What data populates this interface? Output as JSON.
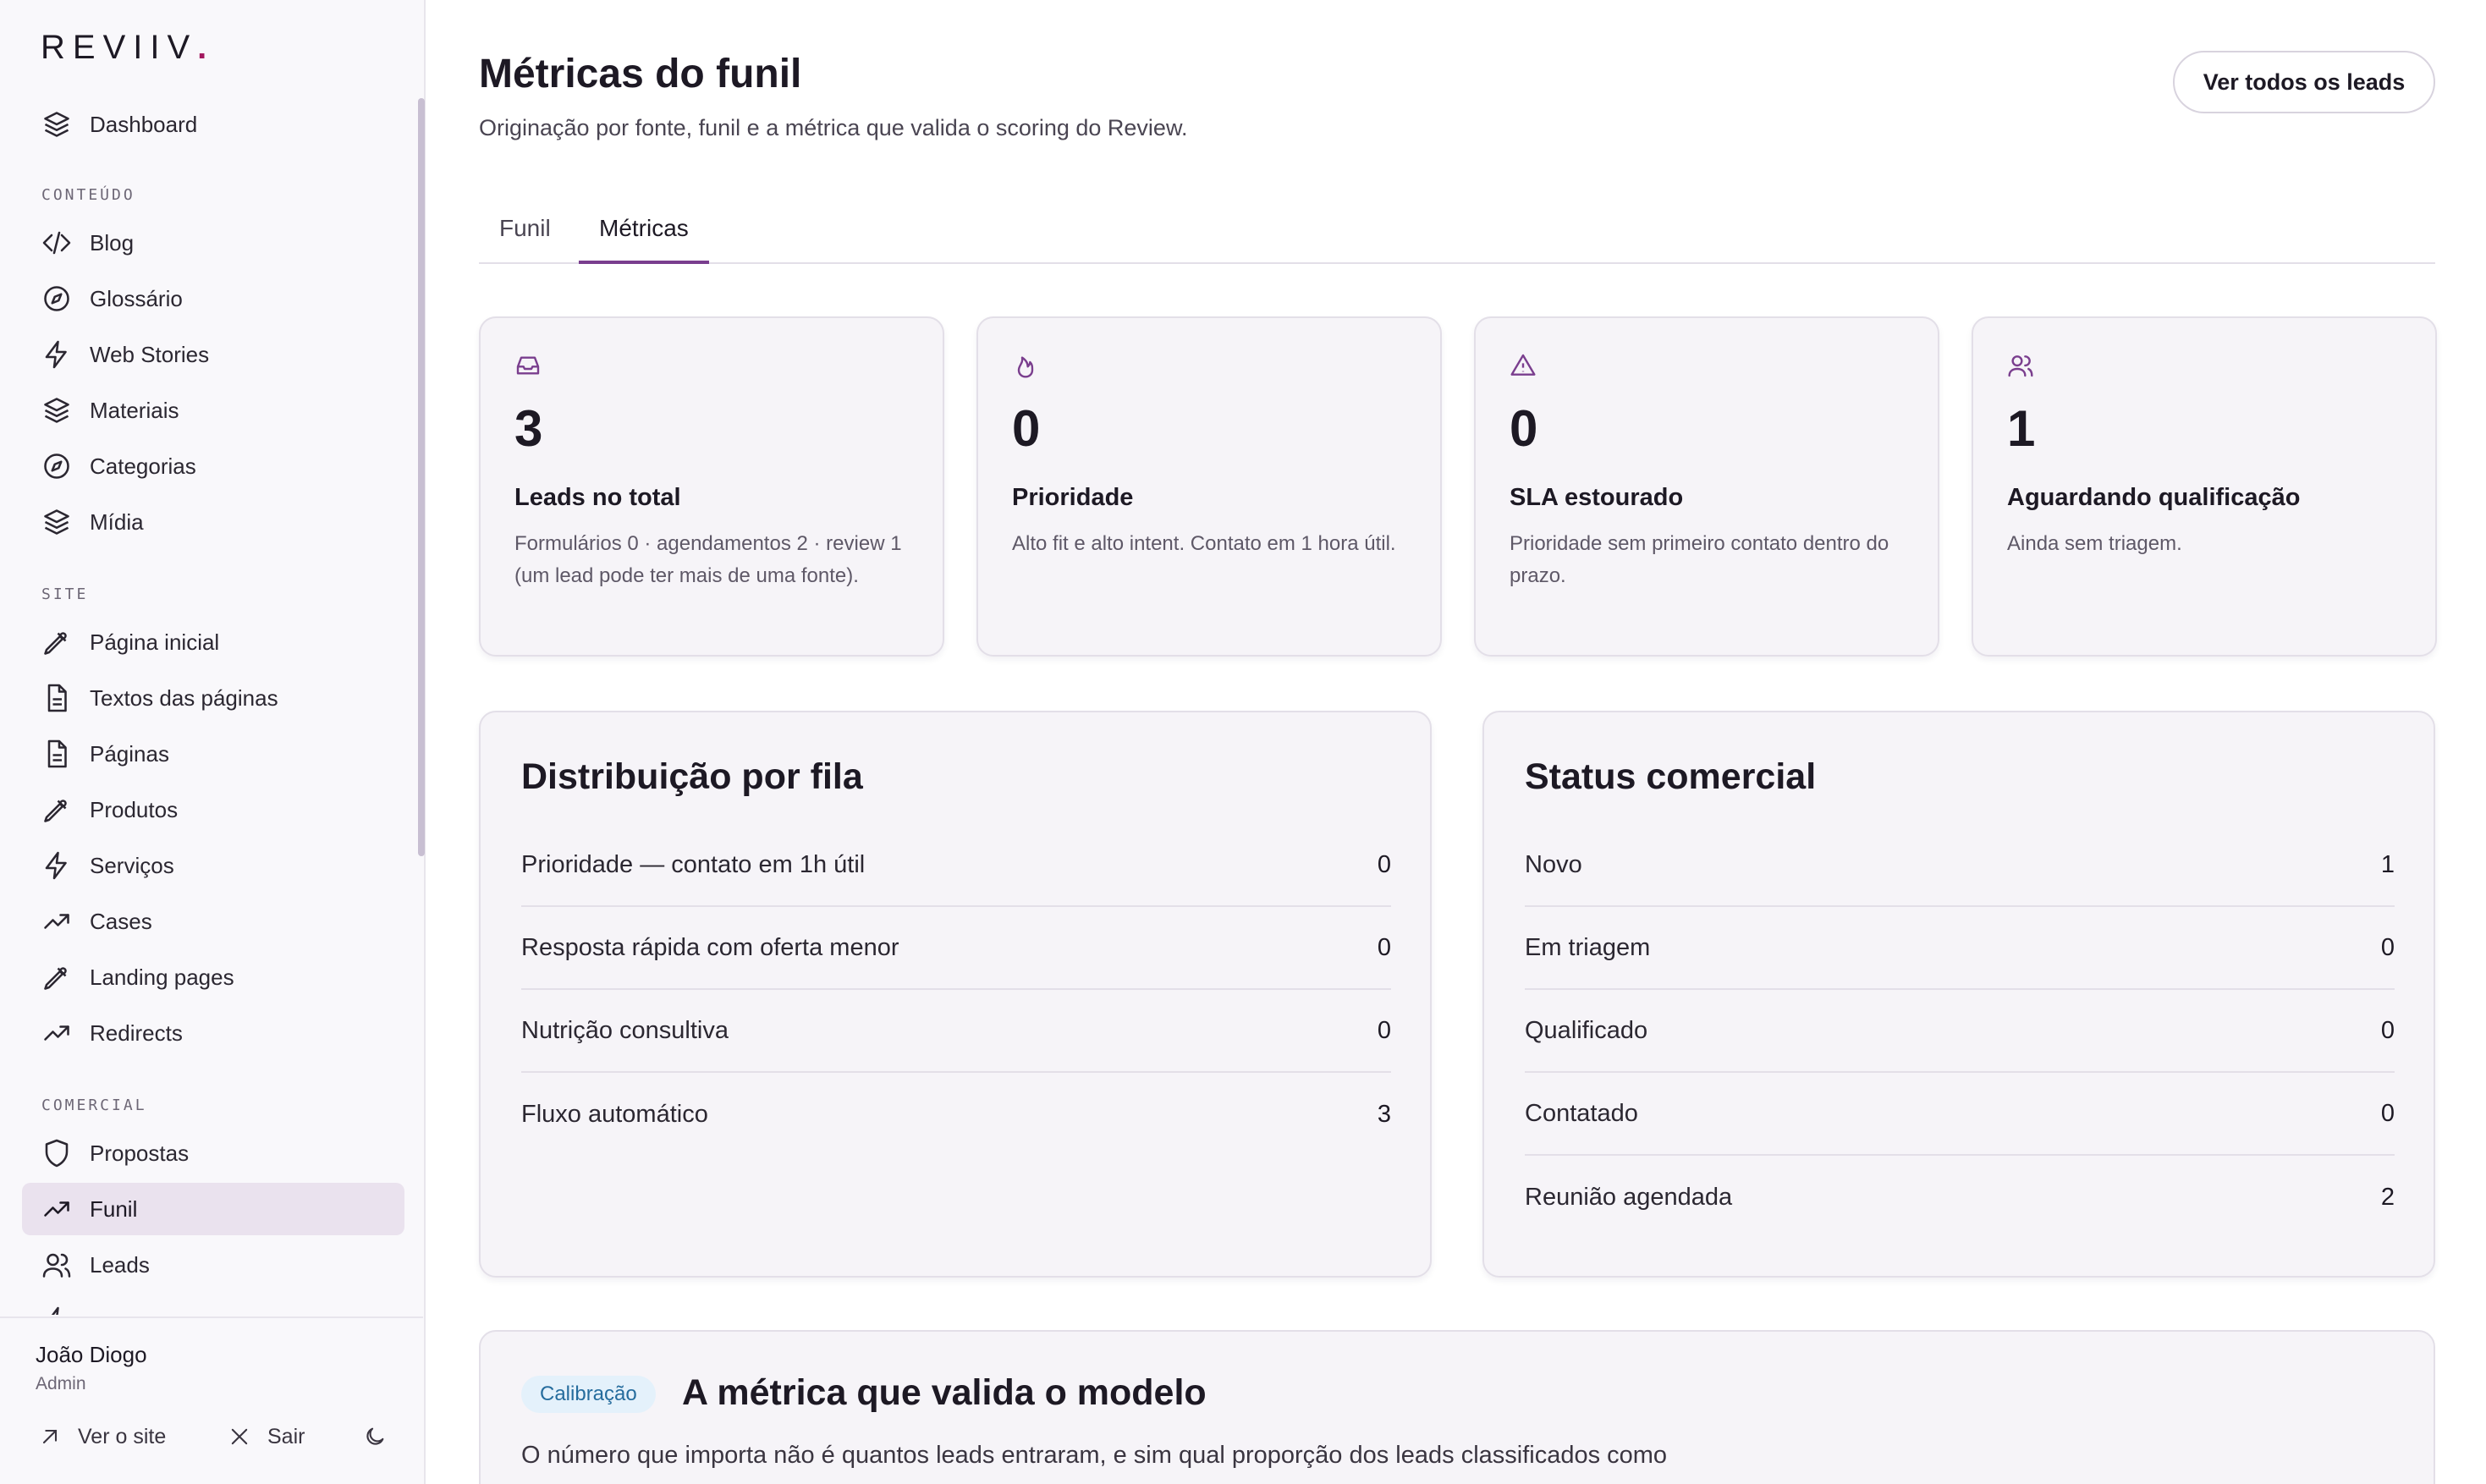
{
  "brand": {
    "logo_text": "REVIIV",
    "logo_dot": "."
  },
  "sidebar": {
    "dashboard": {
      "label": "Dashboard",
      "icon": "layers-icon"
    },
    "sections": [
      {
        "label": "CONTEÚDO"
      },
      {
        "label": "SITE"
      },
      {
        "label": "COMERCIAL"
      }
    ],
    "items": [
      {
        "label": "Blog",
        "icon": "code-icon"
      },
      {
        "label": "Glossário",
        "icon": "compass-icon"
      },
      {
        "label": "Web Stories",
        "icon": "bolt-icon"
      },
      {
        "label": "Materiais",
        "icon": "layers-icon"
      },
      {
        "label": "Categorias",
        "icon": "compass-icon"
      },
      {
        "label": "Mídia",
        "icon": "layers-icon"
      },
      {
        "label": "Página inicial",
        "icon": "tag-icon"
      },
      {
        "label": "Textos das páginas",
        "icon": "document-icon"
      },
      {
        "label": "Páginas",
        "icon": "document-icon"
      },
      {
        "label": "Produtos",
        "icon": "tag-icon"
      },
      {
        "label": "Serviços",
        "icon": "bolt-icon"
      },
      {
        "label": "Cases",
        "icon": "trending-icon"
      },
      {
        "label": "Landing pages",
        "icon": "tag-icon"
      },
      {
        "label": "Redirects",
        "icon": "trending-icon"
      },
      {
        "label": "Propostas",
        "icon": "shield-icon"
      },
      {
        "label": "Funil",
        "icon": "trending-icon",
        "active": true
      },
      {
        "label": "Leads",
        "icon": "users-icon"
      }
    ],
    "user": {
      "name": "João Diogo",
      "role": "Admin"
    },
    "footer_actions": {
      "view_site": "Ver o site",
      "logout": "Sair"
    }
  },
  "header": {
    "title": "Métricas do funil",
    "subtitle": "Originação por fonte, funil e a métrica que valida o scoring do Review.",
    "all_leads_button": "Ver todos os leads"
  },
  "tabs": [
    {
      "label": "Funil",
      "active": false
    },
    {
      "label": "Métricas",
      "active": true
    }
  ],
  "stats": [
    {
      "icon": "inbox-icon",
      "value": "3",
      "label": "Leads no total",
      "desc": "Formulários 0 · agendamentos 2 · review 1 (um lead pode ter mais de uma fonte)."
    },
    {
      "icon": "flame-icon",
      "value": "0",
      "label": "Prioridade",
      "desc": "Alto fit e alto intent. Contato em 1 hora útil."
    },
    {
      "icon": "alert-triangle-icon",
      "value": "0",
      "label": "SLA estourado",
      "desc": "Prioridade sem primeiro contato dentro do prazo."
    },
    {
      "icon": "users-icon",
      "value": "1",
      "label": "Aguardando qualificação",
      "desc": "Ainda sem triagem."
    }
  ],
  "queue_distribution": {
    "title": "Distribuição por fila",
    "rows": [
      {
        "label": "Prioridade — contato em 1h útil",
        "value": "0"
      },
      {
        "label": "Resposta rápida com oferta menor",
        "value": "0"
      },
      {
        "label": "Nutrição consultiva",
        "value": "0"
      },
      {
        "label": "Fluxo automático",
        "value": "3"
      }
    ]
  },
  "commercial_status": {
    "title": "Status comercial",
    "rows": [
      {
        "label": "Novo",
        "value": "1"
      },
      {
        "label": "Em triagem",
        "value": "0"
      },
      {
        "label": "Qualificado",
        "value": "0"
      },
      {
        "label": "Contatado",
        "value": "0"
      },
      {
        "label": "Reunião agendada",
        "value": "2"
      }
    ]
  },
  "calibration": {
    "badge": "Calibração",
    "title": "A métrica que valida o modelo",
    "text": "O número que importa não é quantos leads entraram, e sim qual proporção dos leads classificados como"
  },
  "colors": {
    "accent": "#7a3e8e",
    "logo_dot": "#a3185f",
    "active_nav_bg": "#eae2ee",
    "badge_bg": "#e4f1fb",
    "badge_text": "#256c9d"
  }
}
